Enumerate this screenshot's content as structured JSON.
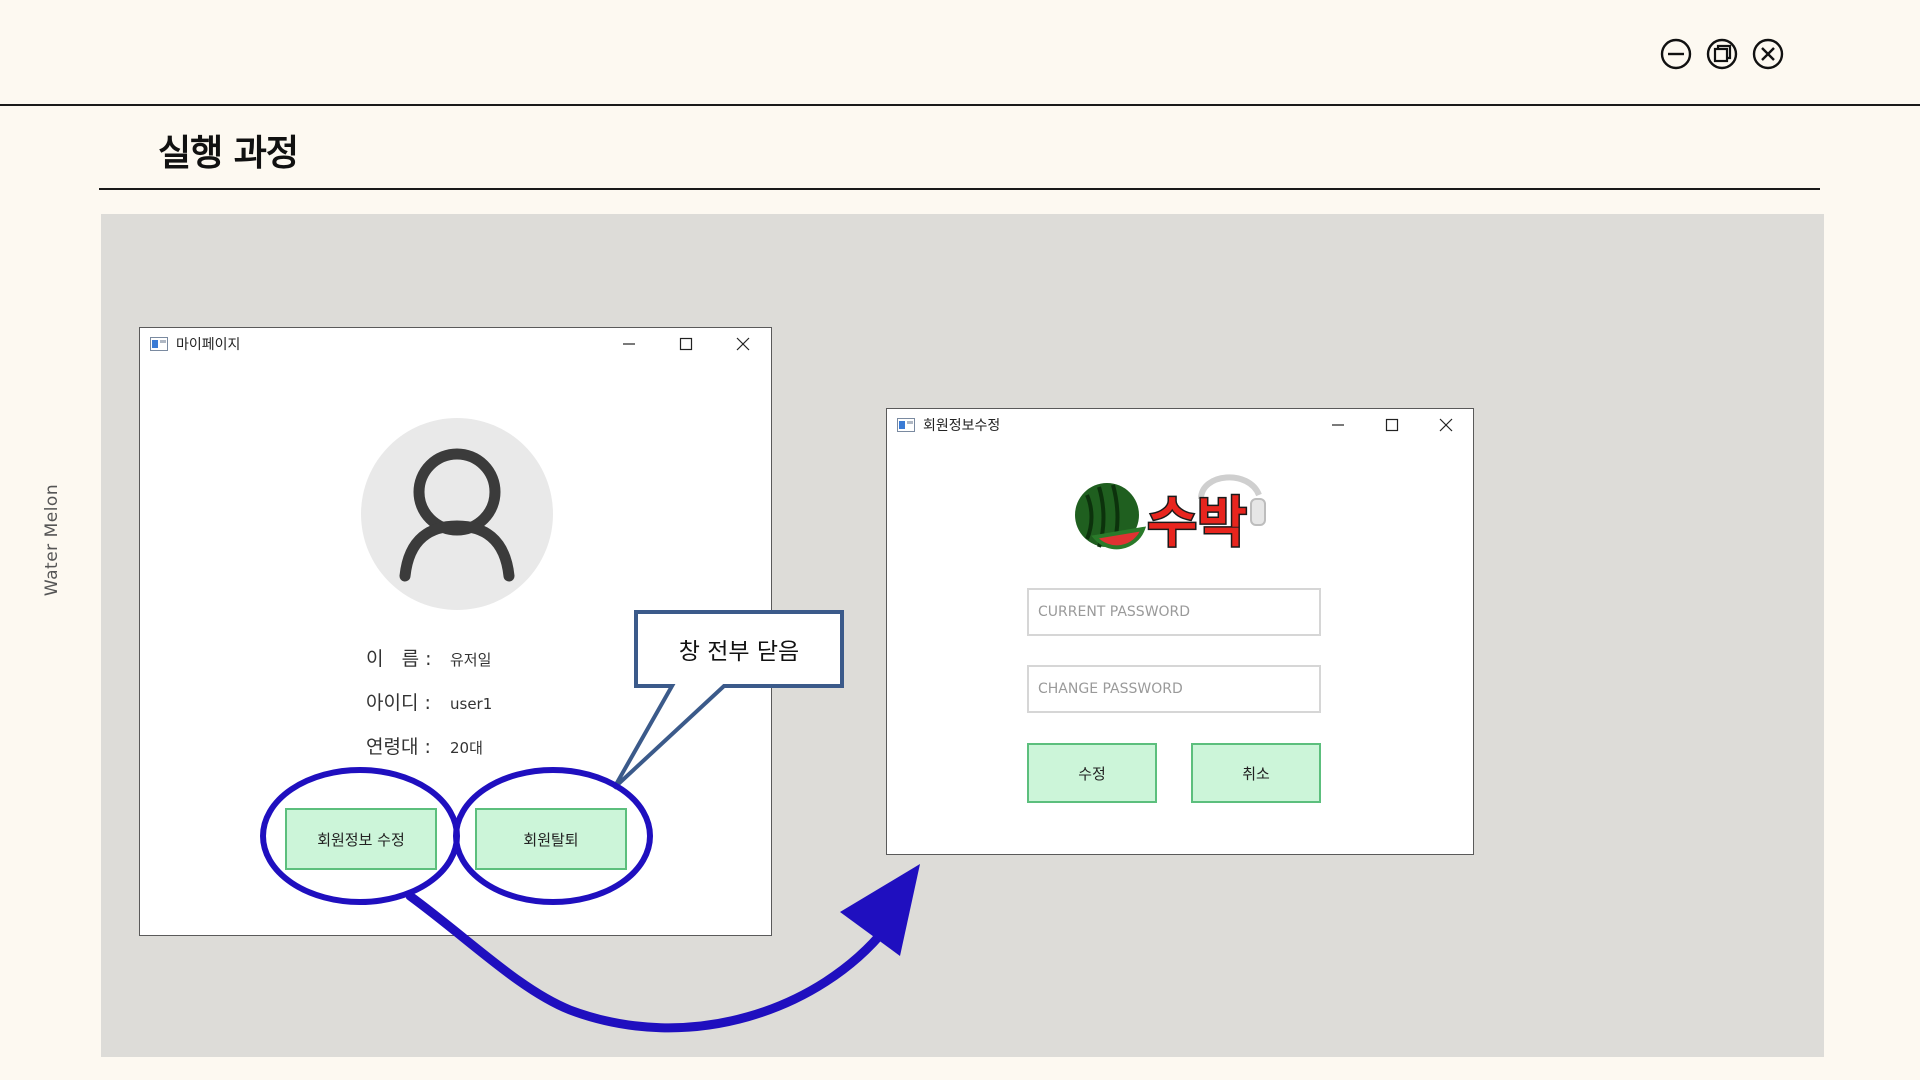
{
  "slide": {
    "title": "실행 과정",
    "side_text": "Water Melon"
  },
  "mypage_window": {
    "title": "마이페이지",
    "fields": [
      {
        "label": "이   름 :",
        "value": "유저일"
      },
      {
        "label": "아이디 :",
        "value": "user1"
      },
      {
        "label": "연령대 :",
        "value": "20대"
      }
    ],
    "edit_button": "회원정보 수정",
    "withdraw_button": "회원탈퇴"
  },
  "edit_window": {
    "title": "회원정보수정",
    "logo_text": "수박",
    "current_password_placeholder": "CURRENT PASSWORD",
    "change_password_placeholder": "CHANGE PASSWORD",
    "confirm_button": "수정",
    "cancel_button": "취소"
  },
  "callout": {
    "text": "창 전부 닫음"
  },
  "colors": {
    "background": "#fdf9f1",
    "panel": "#dddcd8",
    "button_fill": "#ccf5d9",
    "button_border": "#5cbf7d",
    "annotation": "#1f0fbf",
    "callout_border": "#3b5a8a"
  }
}
